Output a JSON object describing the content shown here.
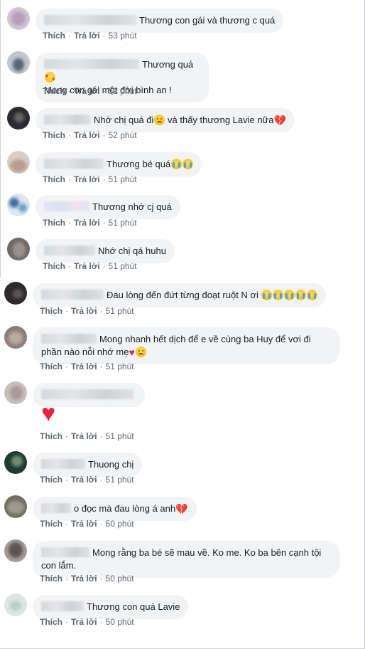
{
  "actions": {
    "like": "Thích",
    "reply": "Trả lời",
    "sep": "·"
  },
  "comments": [
    {
      "text": "Thương con gái và thương c quá",
      "time": "53 phút"
    },
    {
      "text": "Thương quá",
      "text2": "Mong con gái một đời bình an !",
      "time": "52 phút",
      "emoji": "smiling-face-with-hearts"
    },
    {
      "text": "Nhớ chị quá đi",
      "text_b": " và thấy thương Lavie nữa",
      "time": "52 phút",
      "emoji": "disappointed-face",
      "emoji_b": "broken-heart"
    },
    {
      "text": "Thương bé quá",
      "time": "51 phút",
      "emoji": "crying-face"
    },
    {
      "text": "Thương nhớ cj quá",
      "time": "51 phút"
    },
    {
      "text": "Nhớ chị qá huhu",
      "time": "51 phút"
    },
    {
      "text": "Đau lòng đến đứt từng đoạt ruột N ơi",
      "time": "51 phút",
      "emoji": "crying-face"
    },
    {
      "text": "Mong nhanh hết dịch để e về cùng ba Huy để vơi đi",
      "text2": "phần nào nỗi nhớ mẹ",
      "time": "51 phút",
      "emoji": "red-heart",
      "emoji_b": "pensive-face"
    },
    {
      "text": "",
      "time": "51 phút",
      "emoji": "red-heart"
    },
    {
      "text": "Thuong chị",
      "time": "51 phút"
    },
    {
      "text": "o đọc mà đau lòng á anh",
      "time": "50 phút",
      "emoji": "broken-heart"
    },
    {
      "text": "Mong rằng ba bé sẽ mau về. Ko me. Ko ba bên cạnh tội",
      "text2": "con lắm.",
      "time": "50 phút"
    },
    {
      "text": "Thương con quá Lavie",
      "time": "50 phút"
    }
  ]
}
